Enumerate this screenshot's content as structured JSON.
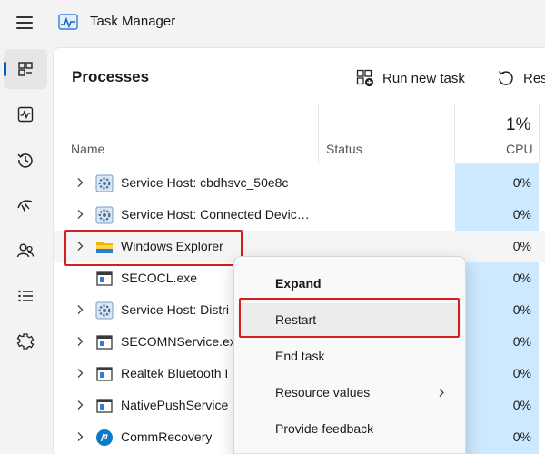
{
  "window": {
    "title": "Task Manager"
  },
  "nav": {
    "items": [
      {
        "icon": "processes-icon",
        "active": true
      },
      {
        "icon": "performance-icon",
        "active": false
      },
      {
        "icon": "app-history-icon",
        "active": false
      },
      {
        "icon": "startup-apps-icon",
        "active": false
      },
      {
        "icon": "users-icon",
        "active": false
      },
      {
        "icon": "details-icon",
        "active": false
      },
      {
        "icon": "services-icon",
        "active": false
      }
    ]
  },
  "header": {
    "title": "Processes",
    "run_new_task": "Run new task",
    "restart_partial": "Res"
  },
  "columns": {
    "name": "Name",
    "status": "Status",
    "cpu_total": "1%",
    "cpu": "CPU"
  },
  "processes": [
    {
      "name": "Service Host: cbdhsvc_50e8c",
      "cpu": "0%",
      "icon": "gear-icon",
      "expandable": true
    },
    {
      "name": "Service Host: Connected Devic…",
      "cpu": "0%",
      "icon": "gear-icon",
      "expandable": true
    },
    {
      "name": "Windows Explorer",
      "cpu": "0%",
      "icon": "folder-icon",
      "expandable": true
    },
    {
      "name": "SECOCL.exe",
      "cpu": "0%",
      "icon": "window-icon",
      "expandable": false
    },
    {
      "name": "Service Host: Distri",
      "cpu": "0%",
      "icon": "gear-icon",
      "expandable": true
    },
    {
      "name": "SECOMNService.ex",
      "cpu": "0%",
      "icon": "window-icon",
      "expandable": true
    },
    {
      "name": "Realtek Bluetooth I",
      "cpu": "0%",
      "icon": "window-icon",
      "expandable": true
    },
    {
      "name": "NativePushService",
      "cpu": "0%",
      "icon": "window-icon",
      "expandable": true
    },
    {
      "name": "CommRecovery",
      "cpu": "0%",
      "icon": "hp-icon",
      "expandable": true
    }
  ],
  "context_menu": {
    "expand": "Expand",
    "restart": "Restart",
    "end_task": "End task",
    "resource_values": "Resource values",
    "provide_feedback": "Provide feedback"
  },
  "colors": {
    "accent": "#005fb8",
    "cpu_highlight": "#cce9ff",
    "annotation": "#d21f1f"
  }
}
